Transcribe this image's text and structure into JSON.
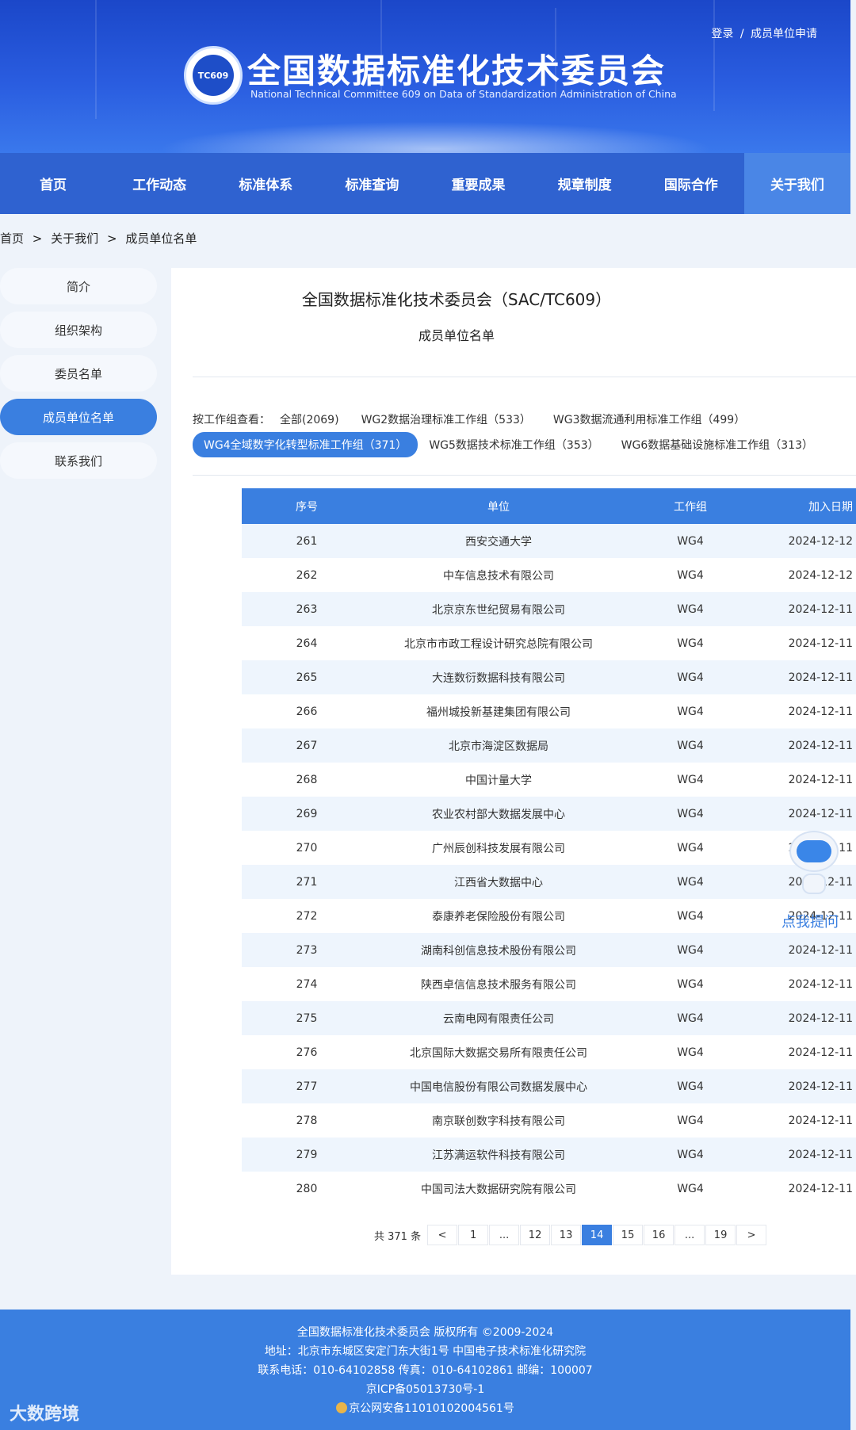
{
  "header": {
    "login_link": "登录",
    "separator": "/",
    "apply_link": "成员单位申请",
    "emblem_text": "TC609",
    "title": "全国数据标准化技术委员会",
    "subtitle": "National Technical Committee 609 on Data of Standardization Administration of China"
  },
  "nav": {
    "items": [
      "首页",
      "工作动态",
      "标准体系",
      "标准查询",
      "重要成果",
      "规章制度",
      "国际合作",
      "关于我们"
    ],
    "active": "关于我们"
  },
  "breadcrumb": {
    "home": "首页",
    "sep1": ">",
    "about": "关于我们",
    "sep2": ">",
    "current": "成员单位名单"
  },
  "sidebar": {
    "items": [
      "简介",
      "组织架构",
      "委员名单",
      "成员单位名单",
      "联系我们"
    ],
    "active": "成员单位名单"
  },
  "main": {
    "title": "全国数据标准化技术委员会（SAC/TC609）",
    "subtitle": "成员单位名单",
    "filter_label": "按工作组查看：",
    "filters": [
      "全部(2069)",
      "WG2数据治理标准工作组（533）",
      "WG3数据流通利用标准工作组（499）",
      "WG4全域数字化转型标准工作组（371）",
      "WG5数据技术标准工作组（353）",
      "WG6数据基础设施标准工作组（313）"
    ],
    "active_filter": "WG4全域数字化转型标准工作组（371）"
  },
  "table": {
    "headers": [
      "序号",
      "单位",
      "工作组",
      "加入日期"
    ],
    "rows": [
      [
        "261",
        "西安交通大学",
        "WG4",
        "2024-12-12"
      ],
      [
        "262",
        "中车信息技术有限公司",
        "WG4",
        "2024-12-12"
      ],
      [
        "263",
        "北京京东世纪贸易有限公司",
        "WG4",
        "2024-12-11"
      ],
      [
        "264",
        "北京市市政工程设计研究总院有限公司",
        "WG4",
        "2024-12-11"
      ],
      [
        "265",
        "大连数衍数据科技有限公司",
        "WG4",
        "2024-12-11"
      ],
      [
        "266",
        "福州城投新基建集团有限公司",
        "WG4",
        "2024-12-11"
      ],
      [
        "267",
        "北京市海淀区数据局",
        "WG4",
        "2024-12-11"
      ],
      [
        "268",
        "中国计量大学",
        "WG4",
        "2024-12-11"
      ],
      [
        "269",
        "农业农村部大数据发展中心",
        "WG4",
        "2024-12-11"
      ],
      [
        "270",
        "广州辰创科技发展有限公司",
        "WG4",
        "2024-12-11"
      ],
      [
        "271",
        "江西省大数据中心",
        "WG4",
        "2024-12-11"
      ],
      [
        "272",
        "泰康养老保险股份有限公司",
        "WG4",
        "2024-12-11"
      ],
      [
        "273",
        "湖南科创信息技术股份有限公司",
        "WG4",
        "2024-12-11"
      ],
      [
        "274",
        "陕西卓信信息技术服务有限公司",
        "WG4",
        "2024-12-11"
      ],
      [
        "275",
        "云南电网有限责任公司",
        "WG4",
        "2024-12-11"
      ],
      [
        "276",
        "北京国际大数据交易所有限责任公司",
        "WG4",
        "2024-12-11"
      ],
      [
        "277",
        "中国电信股份有限公司数据发展中心",
        "WG4",
        "2024-12-11"
      ],
      [
        "278",
        "南京联创数字科技有限公司",
        "WG4",
        "2024-12-11"
      ],
      [
        "279",
        "江苏满运软件科技有限公司",
        "WG4",
        "2024-12-11"
      ],
      [
        "280",
        "中国司法大数据研究院有限公司",
        "WG4",
        "2024-12-11"
      ]
    ]
  },
  "pagination": {
    "total": "共 371 条",
    "prev": "<",
    "next": ">",
    "pages": [
      "1",
      "...",
      "12",
      "13",
      "14",
      "15",
      "16",
      "...",
      "19"
    ],
    "active": "14"
  },
  "assistant": {
    "label": "点我提问"
  },
  "footer": {
    "copyright": "全国数据标准化技术委员会 版权所有 ©2009-2024",
    "address": "地址：北京市东城区安定门东大街1号 中国电子技术标准化研究院",
    "contact": "联系电话：010-64102858 传真：010-64102861 邮编：100007",
    "icp": "京ICP备05013730号-1",
    "police": "京公网安备11010102004561号",
    "watermark": "大数跨境"
  },
  "colors": {
    "primary": "#3a7fe0",
    "nav": "#2f62d0",
    "header": "#1b47c9"
  }
}
